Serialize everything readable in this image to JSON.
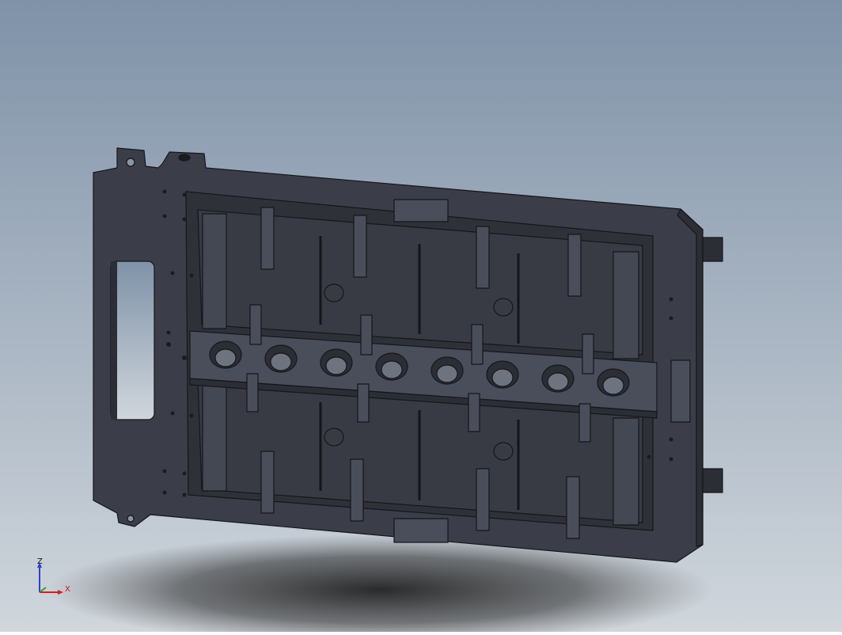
{
  "viewport": {
    "background_top": "#7f92a8",
    "background_bottom": "#d0d6dc"
  },
  "model": {
    "body_color": "#3b3e48",
    "edge_color": "#15161a",
    "shade_color": "#2c2e36",
    "highlight_color": "#4a4e5a",
    "hole_color": "#1b1c22",
    "shadow_color": "#2a2a2a"
  },
  "triad": {
    "z_label": "Z",
    "x_label": "X",
    "z_color": "#2f3fd0",
    "y_color": "#2aa02a",
    "x_color": "#d02020"
  }
}
